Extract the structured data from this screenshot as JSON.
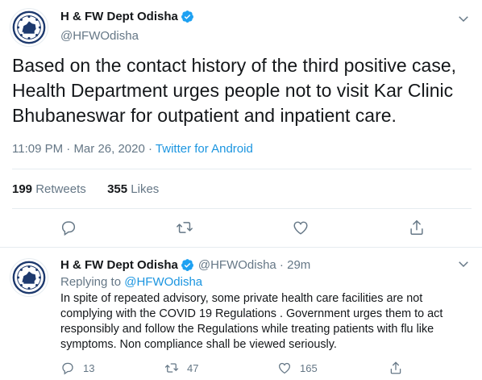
{
  "colors": {
    "text": "#14171a",
    "secondary": "#657786",
    "link": "#1b95e0",
    "divider": "#e6ecf0",
    "verified": "#1da1f2"
  },
  "main_tweet": {
    "display_name": "H & FW Dept Odisha",
    "handle": "@HFWOdisha",
    "text": "Based on the contact history of the third positive case, Health Department urges people not to visit Kar Clinic Bhubaneswar for outpatient and inpatient care.",
    "time": "11:09 PM",
    "date": "Mar 26, 2020",
    "source": "Twitter for Android",
    "retweets_count": "199",
    "retweets_label": "Retweets",
    "likes_count": "355",
    "likes_label": "Likes",
    "icons": [
      "avatar-emblem",
      "verified-badge-icon",
      "chevron-down-icon",
      "reply-icon",
      "retweet-icon",
      "like-icon",
      "share-icon"
    ]
  },
  "reply_tweet": {
    "display_name": "H & FW Dept Odisha",
    "handle": "@HFWOdisha",
    "time_ago": "29m",
    "replying_to_label": "Replying to",
    "replying_to_handle": "@HFWOdisha",
    "text": "In spite of repeated advisory, some private health care facilities are not complying with the COVID 19 Regulations . Government urges them to act responsibly and follow the Regulations while treating patients with flu like symptoms. Non compliance shall be viewed seriously.",
    "reply_count": "13",
    "retweet_count": "47",
    "like_count": "165"
  }
}
